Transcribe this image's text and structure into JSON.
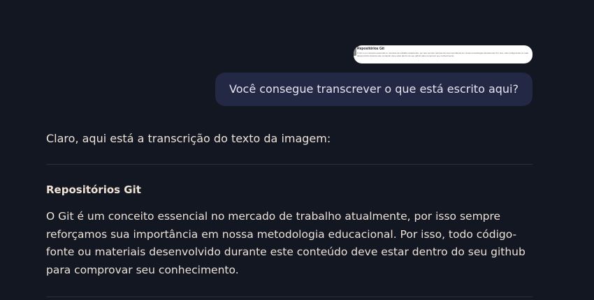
{
  "attachment": {
    "title": "Repositórios Git",
    "lines": [
      "O Git é um conceito essencial no mercado de trabalho atualmente, por isso sempre reforçamos sua importância em nossa metodologia educacional. Por isso, todo código-fonte ou materiais",
      "desenvolvido durante este conteúdo deve estar dentro do seu github para comprovar seu conhecimento."
    ]
  },
  "user_message": "Você consegue transcrever o que está escrito aqui?",
  "assistant": {
    "intro": "Claro, aqui está a transcrição do texto da imagem:",
    "heading": "Repositórios Git",
    "body": "O Git é um conceito essencial no mercado de trabalho atualmente, por isso sempre reforçamos sua importância em nossa metodologia educacional. Por isso, todo código-fonte ou materiais desenvolvido durante este conteúdo deve estar dentro do seu github para comprovar seu conhecimento."
  }
}
